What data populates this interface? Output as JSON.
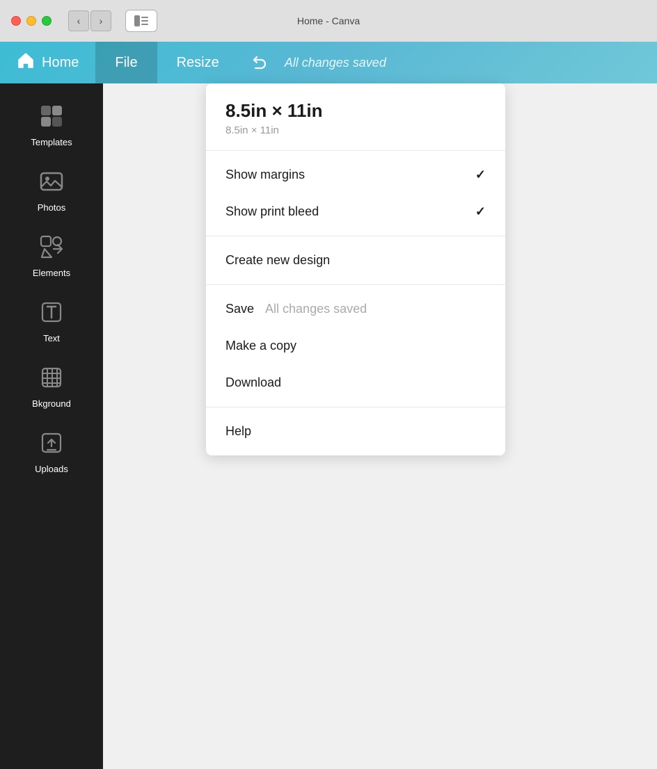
{
  "titlebar": {
    "title": "Home - Canva",
    "back_label": "‹",
    "forward_label": "›"
  },
  "header": {
    "home_label": "Home",
    "file_label": "File",
    "resize_label": "Resize",
    "saved_label": "All changes saved"
  },
  "sidebar": {
    "items": [
      {
        "id": "templates",
        "label": "Templates"
      },
      {
        "id": "photos",
        "label": "Photos"
      },
      {
        "id": "elements",
        "label": "Elements"
      },
      {
        "id": "text",
        "label": "Text"
      },
      {
        "id": "background",
        "label": "Bkground"
      },
      {
        "id": "uploads",
        "label": "Uploads"
      }
    ]
  },
  "dropdown": {
    "size_title": "8.5in × 11in",
    "size_subtitle": "8.5in × 11in",
    "items": {
      "show_margins": "Show margins",
      "show_print_bleed": "Show print bleed",
      "create_new_design": "Create new design",
      "save": "Save",
      "save_status": "All changes saved",
      "make_a_copy": "Make a copy",
      "download": "Download",
      "help": "Help"
    }
  }
}
